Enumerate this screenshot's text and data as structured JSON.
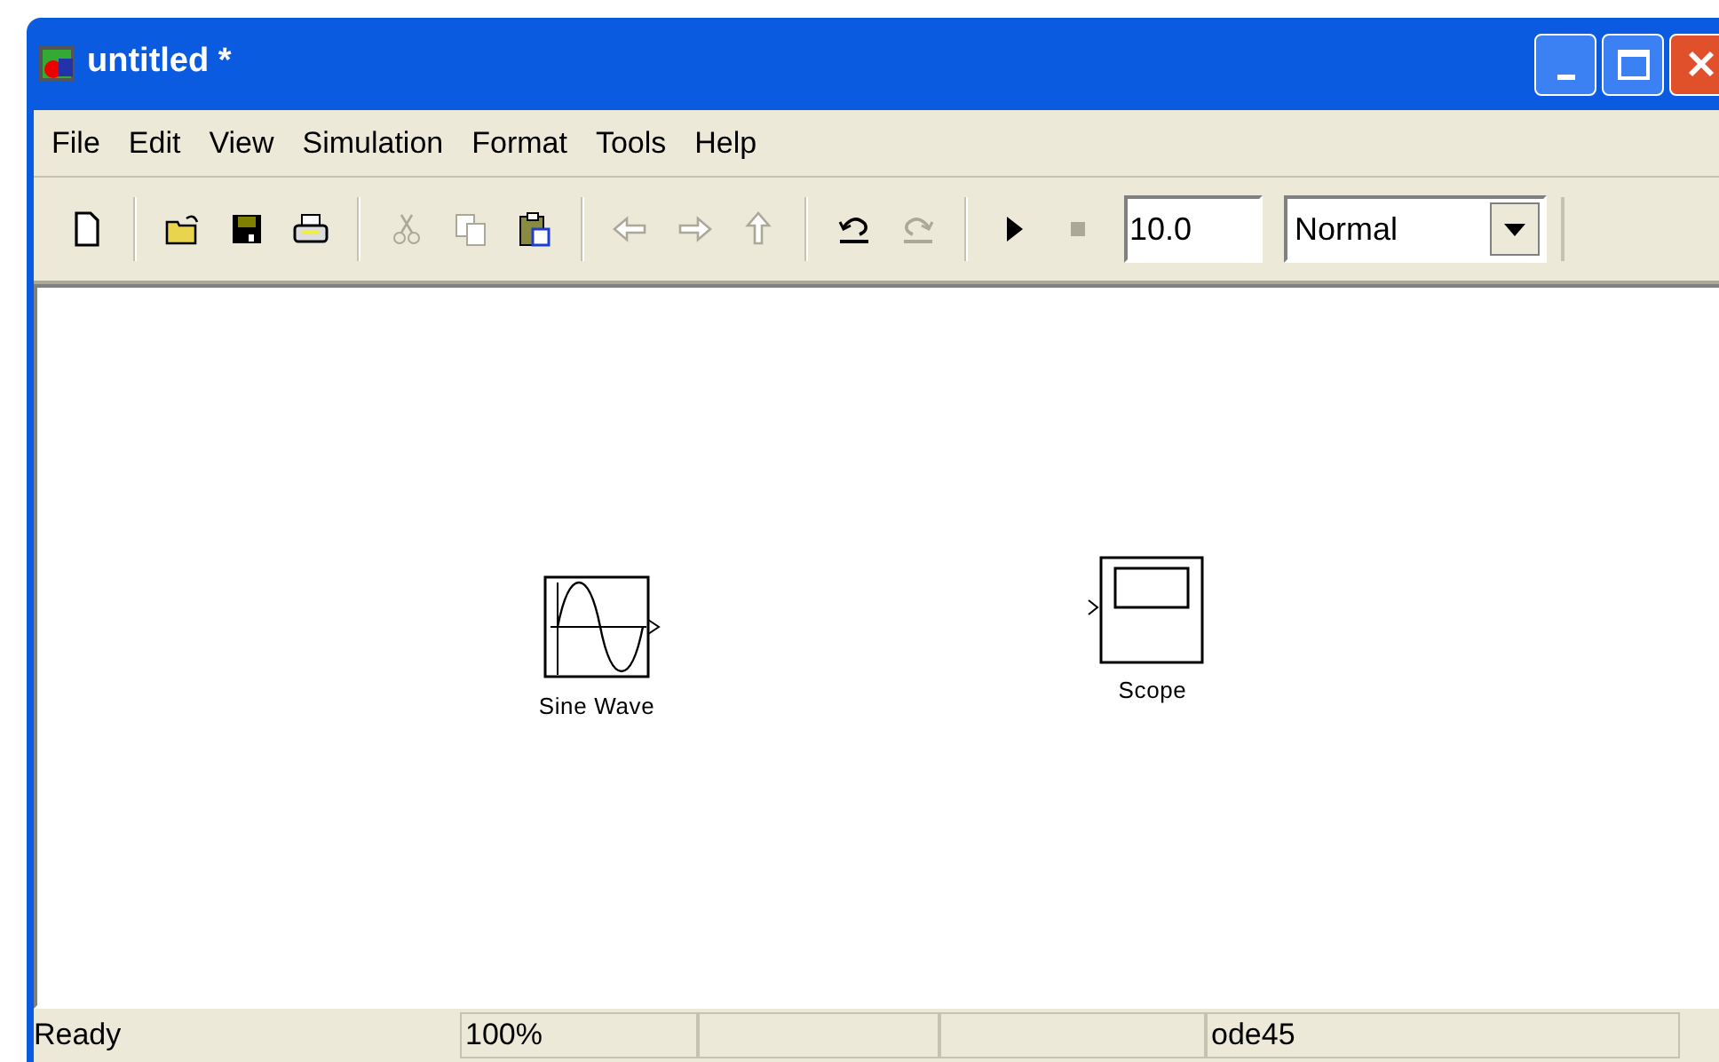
{
  "window": {
    "title": "untitled *"
  },
  "menu": [
    "File",
    "Edit",
    "View",
    "Simulation",
    "Format",
    "Tools",
    "Help"
  ],
  "toolbar": {
    "groups": [
      [
        {
          "kind": "new",
          "disabled": false
        }
      ],
      [
        {
          "kind": "open",
          "disabled": false
        },
        {
          "kind": "save",
          "disabled": false
        },
        {
          "kind": "print",
          "disabled": false
        }
      ],
      [
        {
          "kind": "cut",
          "disabled": true
        },
        {
          "kind": "copy",
          "disabled": true
        },
        {
          "kind": "paste",
          "disabled": false
        }
      ],
      [
        {
          "kind": "back",
          "disabled": true
        },
        {
          "kind": "forward",
          "disabled": true
        },
        {
          "kind": "up",
          "disabled": true
        }
      ],
      [
        {
          "kind": "undo",
          "disabled": false
        },
        {
          "kind": "redo",
          "disabled": true
        }
      ],
      [
        {
          "kind": "start",
          "disabled": false
        },
        {
          "kind": "stop",
          "disabled": true
        }
      ]
    ],
    "stop_time": "10.0",
    "mode": "Normal"
  },
  "blocks": [
    {
      "kind": "sine",
      "label": "Sine Wave"
    },
    {
      "kind": "scope",
      "label": "Scope"
    }
  ],
  "status_bar": [
    {
      "kind": "text",
      "text": "Ready"
    },
    {
      "kind": "text",
      "text": "100%"
    },
    {
      "kind": "empty"
    },
    {
      "kind": "empty"
    },
    {
      "kind": "text",
      "text": "ode45"
    }
  ]
}
